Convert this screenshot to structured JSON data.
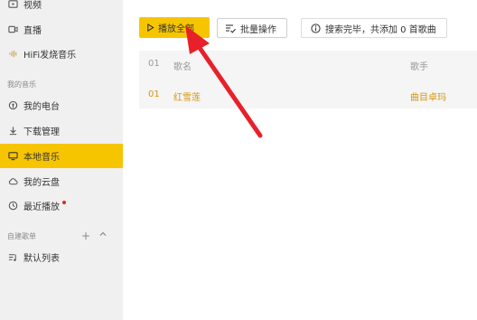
{
  "sidebar": {
    "top_items": [
      {
        "label": "视频",
        "icon": "video-icon"
      },
      {
        "label": "直播",
        "icon": "live-icon"
      },
      {
        "label": "HiFi发烧音乐",
        "icon": "hifi-wave-icon"
      }
    ],
    "my_music_title": "我的音乐",
    "my_music_items": [
      {
        "label": "我的电台",
        "icon": "radio-icon"
      },
      {
        "label": "下载管理",
        "icon": "download-icon"
      },
      {
        "label": "本地音乐",
        "icon": "monitor-icon",
        "active": true
      },
      {
        "label": "我的云盘",
        "icon": "cloud-icon"
      },
      {
        "label": "最近播放",
        "icon": "clock-icon",
        "has_dot": true
      }
    ],
    "playlists_title": "自建歌单",
    "playlists": [
      {
        "label": "默认列表",
        "icon": "playlist-icon"
      }
    ],
    "colors": {
      "active_bg": "#f7c500",
      "dot": "#e0261c"
    }
  },
  "toolbar": {
    "play_all_label": "播放全部",
    "batch_label": "批量操作",
    "status_text": "搜索完毕，共添加 0 首歌曲"
  },
  "table": {
    "header": {
      "index": "01",
      "song": "歌名",
      "artist": "歌手"
    },
    "rows": [
      {
        "index": "01",
        "song": "红雪莲",
        "artist": "曲目卓玛"
      }
    ]
  },
  "colors": {
    "accent": "#f7c500",
    "row_text": "#d4960e",
    "arrow": "#e8202a"
  }
}
